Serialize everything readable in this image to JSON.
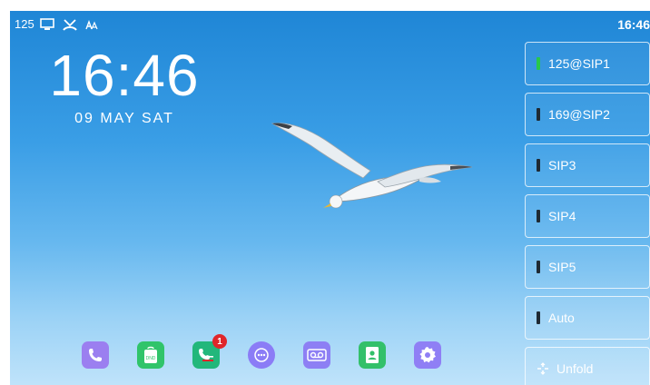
{
  "status_bar": {
    "extension": "125",
    "icons": [
      "network-icon",
      "missed-call-icon",
      "auto-answer-icon"
    ],
    "time": "16:46"
  },
  "clock": {
    "time": "16:46",
    "date": "09 MAY SAT"
  },
  "line_keys": [
    {
      "label": "125@SIP1",
      "status": "registered",
      "color": "#28c84a"
    },
    {
      "label": "169@SIP2",
      "status": "idle",
      "color": "#1f2a33"
    },
    {
      "label": "SIP3",
      "status": "idle",
      "color": "#1f2a33"
    },
    {
      "label": "SIP4",
      "status": "idle",
      "color": "#1f2a33"
    },
    {
      "label": "SIP5",
      "status": "idle",
      "color": "#1f2a33"
    },
    {
      "label": "Auto",
      "status": "idle",
      "color": "#1f2a33"
    }
  ],
  "unfold": {
    "label": "Unfold",
    "icon": "unfold-icon"
  },
  "dock": [
    {
      "name": "phone",
      "icon": "phone-icon",
      "color": "#9b7ff0"
    },
    {
      "name": "dnd",
      "icon": "dnd-icon",
      "color": "#30c46a",
      "text": "DND"
    },
    {
      "name": "call-log",
      "icon": "call-history-icon",
      "color": "#22b77b",
      "badge": "1"
    },
    {
      "name": "more",
      "icon": "more-icon",
      "color": "#8b7cf6"
    },
    {
      "name": "voicemail",
      "icon": "voicemail-icon",
      "color": "#8d7ff4"
    },
    {
      "name": "contacts",
      "icon": "contacts-icon",
      "color": "#33c06a"
    },
    {
      "name": "settings",
      "icon": "settings-icon",
      "color": "#8f7ff5"
    }
  ],
  "colors": {
    "sky_top": "#1f86d6",
    "sky_bottom": "#bfe3fa",
    "registered": "#28c84a",
    "badge": "#e0262a"
  }
}
